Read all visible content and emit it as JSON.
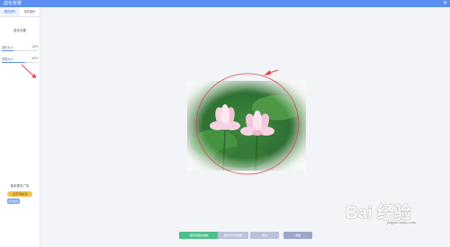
{
  "window": {
    "title": "虚化背景",
    "close_glyph": "✕"
  },
  "sidebar": {
    "tabs": [
      {
        "label": "圆形虚化",
        "active": true
      },
      {
        "label": "径向虚化",
        "active": false
      }
    ],
    "section_title": "虚化设置",
    "sliders": [
      {
        "label": "虚化大小",
        "value_text": "33%",
        "value": 0.33
      },
      {
        "label": "范围大小",
        "value_text": "65%",
        "value": 0.65
      }
    ],
    "cta": {
      "title": "使用更多广告",
      "gold_button": "立即开通会员",
      "blue_button": "取消会员"
    }
  },
  "bottom_buttons": {
    "save": "保存到我的电脑",
    "b2": "保存到手机相册",
    "b3": "重选",
    "b4": "撤销"
  },
  "watermark": {
    "text": "Bai 经验",
    "sub": "jingyan.baidu.com"
  },
  "colors": {
    "accent": "#5a8ef0",
    "annotation": "#e0484a",
    "save_green": "#4ec08a",
    "gold": "#f0c34c"
  }
}
